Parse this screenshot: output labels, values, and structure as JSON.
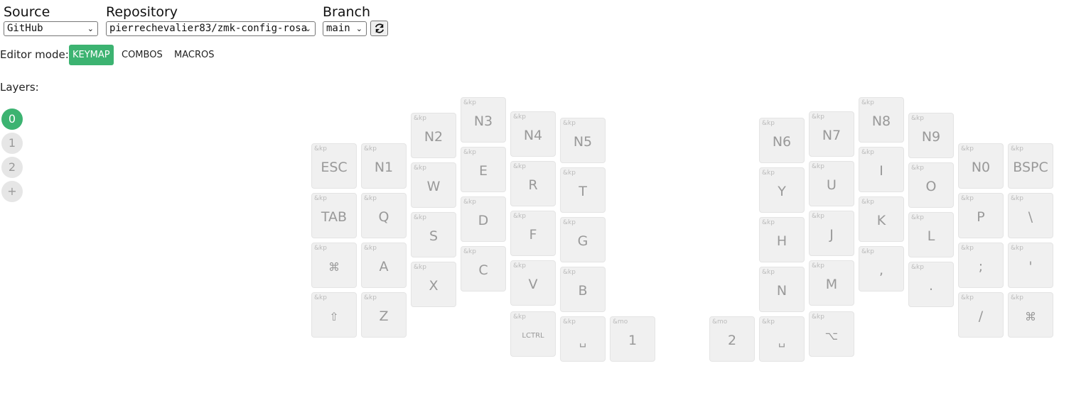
{
  "toolbar": {
    "source_label": "Source",
    "source_value": "GitHub",
    "repository_label": "Repository",
    "repository_value": "pierrechevalier83/zmk-config-rosa",
    "branch_label": "Branch",
    "branch_value": "main",
    "refresh_icon": "refresh-icon",
    "chevron": "⌄"
  },
  "editor_mode": {
    "label": "Editor mode:",
    "modes": [
      "KEYMAP",
      "COMBOS",
      "MACROS"
    ],
    "active": "KEYMAP"
  },
  "layers": {
    "label": "Layers:",
    "items": [
      "0",
      "1",
      "2",
      "+"
    ],
    "active": "0"
  },
  "keys": [
    {
      "behavior": "&kp",
      "label": "ESC"
    },
    {
      "behavior": "&kp",
      "label": "N1"
    },
    {
      "behavior": "&kp",
      "label": "N2"
    },
    {
      "behavior": "&kp",
      "label": "N3"
    },
    {
      "behavior": "&kp",
      "label": "N4"
    },
    {
      "behavior": "&kp",
      "label": "N5"
    },
    {
      "behavior": "&kp",
      "label": "N6"
    },
    {
      "behavior": "&kp",
      "label": "N7"
    },
    {
      "behavior": "&kp",
      "label": "N8"
    },
    {
      "behavior": "&kp",
      "label": "N9"
    },
    {
      "behavior": "&kp",
      "label": "N0"
    },
    {
      "behavior": "&kp",
      "label": "BSPC"
    },
    {
      "behavior": "&kp",
      "label": "TAB"
    },
    {
      "behavior": "&kp",
      "label": "Q"
    },
    {
      "behavior": "&kp",
      "label": "W"
    },
    {
      "behavior": "&kp",
      "label": "E"
    },
    {
      "behavior": "&kp",
      "label": "R"
    },
    {
      "behavior": "&kp",
      "label": "T"
    },
    {
      "behavior": "&kp",
      "label": "Y"
    },
    {
      "behavior": "&kp",
      "label": "U"
    },
    {
      "behavior": "&kp",
      "label": "I"
    },
    {
      "behavior": "&kp",
      "label": "O"
    },
    {
      "behavior": "&kp",
      "label": "P"
    },
    {
      "behavior": "&kp",
      "label": "\\"
    },
    {
      "behavior": "&kp",
      "label": "⌘"
    },
    {
      "behavior": "&kp",
      "label": "A"
    },
    {
      "behavior": "&kp",
      "label": "S"
    },
    {
      "behavior": "&kp",
      "label": "D"
    },
    {
      "behavior": "&kp",
      "label": "F"
    },
    {
      "behavior": "&kp",
      "label": "G"
    },
    {
      "behavior": "&kp",
      "label": "H"
    },
    {
      "behavior": "&kp",
      "label": "J"
    },
    {
      "behavior": "&kp",
      "label": "K"
    },
    {
      "behavior": "&kp",
      "label": "L"
    },
    {
      "behavior": "&kp",
      "label": ";"
    },
    {
      "behavior": "&kp",
      "label": "'"
    },
    {
      "behavior": "&kp",
      "label": "⇧"
    },
    {
      "behavior": "&kp",
      "label": "Z"
    },
    {
      "behavior": "&kp",
      "label": "X"
    },
    {
      "behavior": "&kp",
      "label": "C"
    },
    {
      "behavior": "&kp",
      "label": "V"
    },
    {
      "behavior": "&kp",
      "label": "B"
    },
    {
      "behavior": "&kp",
      "label": "N"
    },
    {
      "behavior": "&kp",
      "label": "M"
    },
    {
      "behavior": "&kp",
      "label": ","
    },
    {
      "behavior": "&kp",
      "label": "."
    },
    {
      "behavior": "&kp",
      "label": "/"
    },
    {
      "behavior": "&kp",
      "label": "⌘"
    },
    {
      "behavior": "&kp",
      "label": "LCTRL"
    },
    {
      "behavior": "&kp",
      "label": "␣"
    },
    {
      "behavior": "&mo",
      "label": "1"
    },
    {
      "behavior": "&mo",
      "label": "2"
    },
    {
      "behavior": "&kp",
      "label": "␣"
    },
    {
      "behavior": "&kp",
      "label": "⌥"
    }
  ]
}
